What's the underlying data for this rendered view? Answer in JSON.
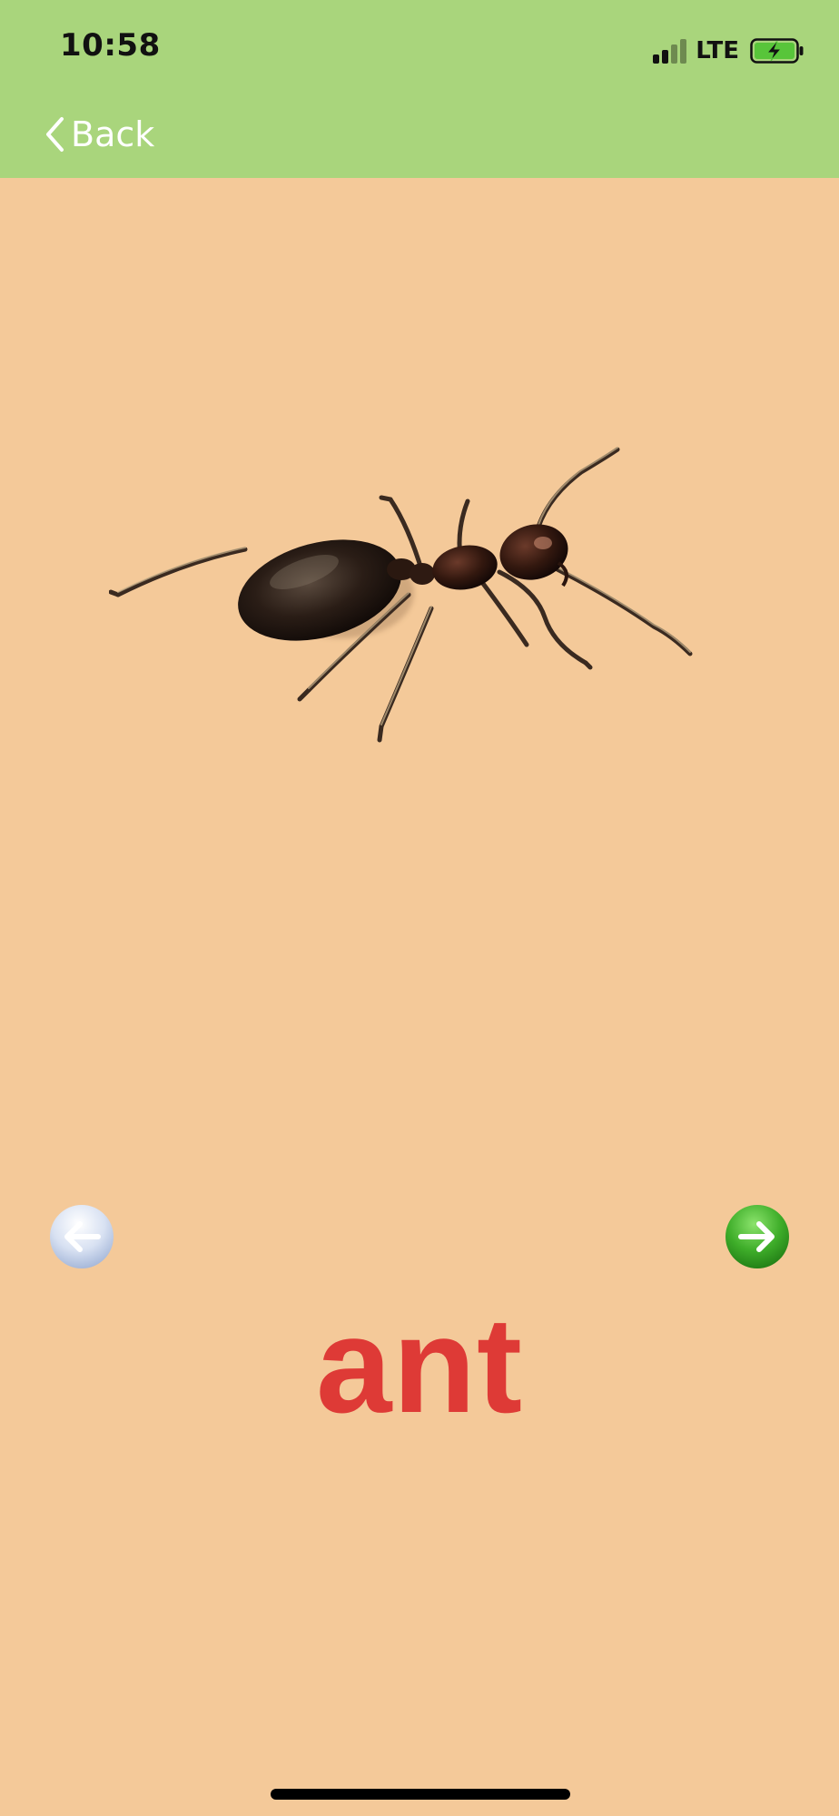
{
  "status_bar": {
    "time": "10:58",
    "network": "LTE",
    "signal_bars": 2,
    "signal_max": 4,
    "battery_state": "charging",
    "battery_icon": "battery-charging-icon"
  },
  "nav": {
    "back_label": "Back",
    "back_icon": "chevron-left-icon"
  },
  "card": {
    "word": "ant",
    "image": "ant-image",
    "prev_icon": "arrow-left-icon",
    "next_icon": "arrow-right-icon"
  },
  "colors": {
    "header_bg": "#A9D57C",
    "page_bg": "#F4C999",
    "word_color": "#DE3A36",
    "next_button": "#3FAE2A",
    "prev_button": "#C9D6EC"
  }
}
